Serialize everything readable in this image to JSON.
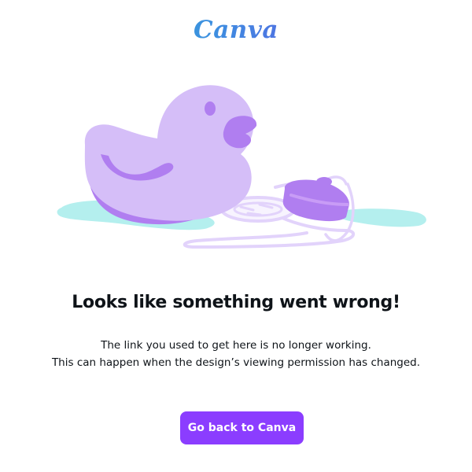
{
  "brand": {
    "logo_text": "Canva"
  },
  "error": {
    "headline": "Looks like something went wrong!",
    "message_line1": "The link you used to get here is no longer working.",
    "message_line2": "This can happen when the design’s viewing permission has changed."
  },
  "actions": {
    "back_label": "Go back to Canva"
  },
  "colors": {
    "accent": "#8b3dff",
    "duck_body": "#d5bef8",
    "duck_dark": "#b07ef0",
    "puddle": "#b4efee",
    "text": "#0e1318"
  },
  "illustration": {
    "icon": "rubber-duck-drain-plug-icon"
  }
}
